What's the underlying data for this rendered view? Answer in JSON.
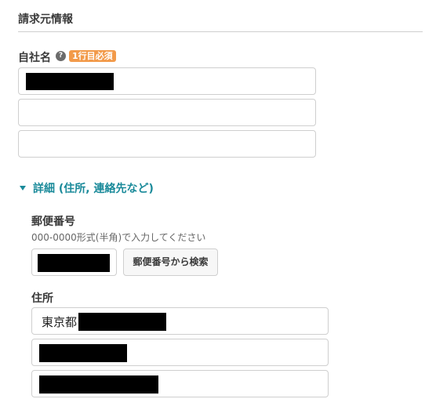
{
  "section": {
    "title": "請求元情報"
  },
  "company": {
    "label": "自社名",
    "help_icon": "question-circle-icon",
    "required_badge": "1行目必須"
  },
  "details_toggle": {
    "label": "詳細 (住所, 連絡先など)",
    "expanded": true,
    "color": "#1a8a9a"
  },
  "postal": {
    "label": "郵便番号",
    "hint": "000-0000形式(半角)で入力してください",
    "search_button": "郵便番号から検索"
  },
  "address": {
    "label": "住所",
    "line1_prefix": "東京都"
  },
  "colors": {
    "badge": "#f29a4a",
    "accent": "#1a8a9a"
  }
}
